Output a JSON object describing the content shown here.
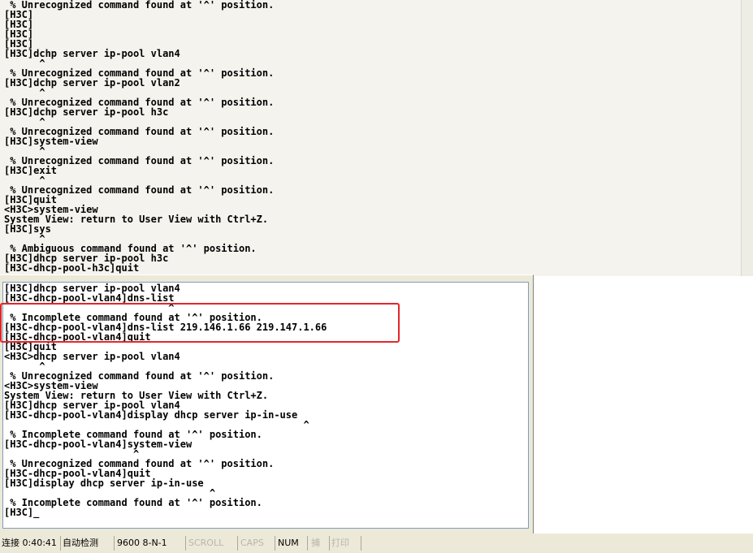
{
  "terminal_top": {
    "lines": [
      " % Unrecognized command found at '^' position.",
      "[H3C]",
      "[H3C]",
      "[H3C]",
      "[H3C]",
      "[H3C]dchp server ip-pool vlan4",
      "      ^",
      " % Unrecognized command found at '^' position.",
      "[H3C]dchp server ip-pool vlan2",
      "      ^",
      " % Unrecognized command found at '^' position.",
      "[H3C]dchp server ip-pool h3c",
      "      ^",
      " % Unrecognized command found at '^' position.",
      "[H3C]system-view",
      "      ^",
      " % Unrecognized command found at '^' position.",
      "[H3C]exit",
      "      ^",
      " % Unrecognized command found at '^' position.",
      "[H3C]quit",
      "<H3C>system-view",
      "System View: return to User View with Ctrl+Z.",
      "[H3C]sys",
      "      ^",
      " % Ambiguous command found at '^' position.",
      "[H3C]dhcp server ip-pool h3c",
      "[H3C-dhcp-pool-h3c]quit"
    ]
  },
  "terminal_bottom": {
    "lines": [
      "[H3C]dhcp server ip-pool vlan4",
      "[H3C-dhcp-pool-vlan4]dns-list",
      "                            ^",
      " % Incomplete command found at '^' position.",
      "[H3C-dhcp-pool-vlan4]dns-list 219.146.1.66 219.147.1.66",
      "[H3C-dhcp-pool-vlan4]quit",
      "[H3C]quit",
      "<H3C>dhcp server ip-pool vlan4",
      "      ^",
      " % Unrecognized command found at '^' position.",
      "<H3C>system-view",
      "System View: return to User View with Ctrl+Z.",
      "[H3C]dhcp server ip-pool vlan4",
      "[H3C-dhcp-pool-vlan4]display dhcp server ip-in-use",
      "                                                   ^",
      " % Incomplete command found at '^' position.",
      "[H3C-dhcp-pool-vlan4]system-view",
      "                      ^",
      " % Unrecognized command found at '^' position.",
      "[H3C-dhcp-pool-vlan4]quit",
      "[H3C]display dhcp server ip-in-use",
      "                                   ^",
      " % Incomplete command found at '^' position.",
      "[H3C]_"
    ]
  },
  "statusbar": {
    "connection": "连接 0:40:41",
    "detect": "自动检测",
    "port": "9600 8-N-1",
    "scroll": "SCROLL",
    "caps": "CAPS",
    "num": "NUM",
    "capture": "捕",
    "print": "打印"
  },
  "colors": {
    "highlight_border": "#e3262b",
    "panel_bg": "#ece9d8",
    "top_bg": "#f4f3ee"
  }
}
